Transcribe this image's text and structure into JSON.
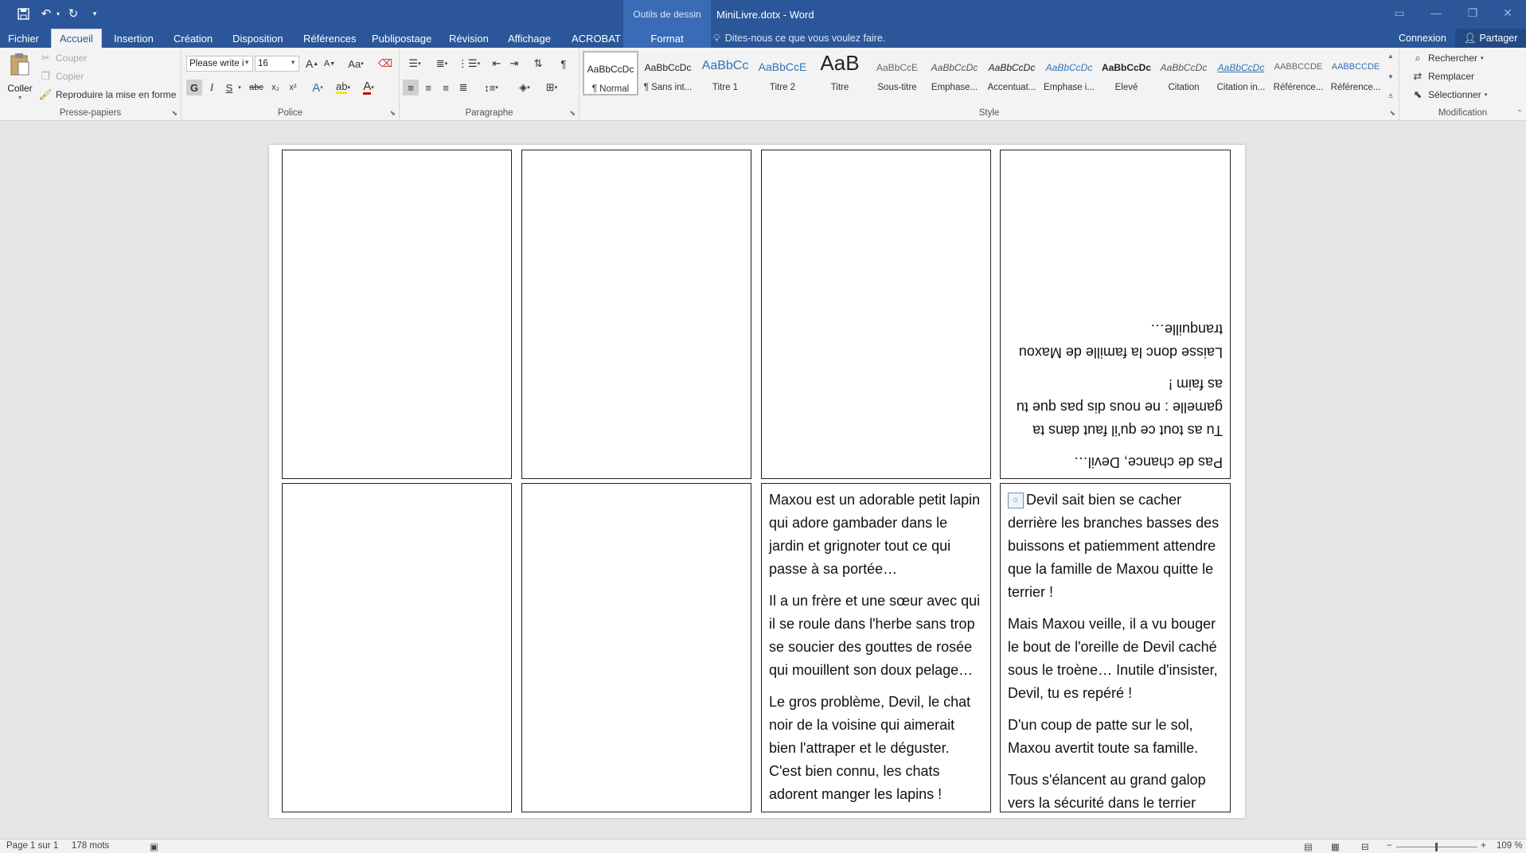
{
  "titlebar": {
    "quick_access": [
      "save-icon",
      "undo-icon",
      "redo-icon",
      "customize-icon"
    ],
    "context_header": "Outils de dessin",
    "doc_title": "MiniLivre.dotx - Word"
  },
  "tabs": [
    {
      "label": "Fichier"
    },
    {
      "label": "Accueil"
    },
    {
      "label": "Insertion"
    },
    {
      "label": "Création"
    },
    {
      "label": "Disposition"
    },
    {
      "label": "Références"
    },
    {
      "label": "Publipostage"
    },
    {
      "label": "Révision"
    },
    {
      "label": "Affichage"
    },
    {
      "label": "ACROBAT"
    },
    {
      "label": "Format"
    }
  ],
  "tellme": "Dites-nous ce que vous voulez faire.",
  "account": {
    "signin": "Connexion",
    "share": "Partager"
  },
  "ribbon": {
    "clipboard": {
      "paste": "Coller",
      "cut": "Couper",
      "copy": "Copier",
      "format_painter": "Reproduire la mise en forme",
      "label": "Presse-papiers"
    },
    "font": {
      "name": "Please write i",
      "size": "16",
      "label": "Police",
      "bold": "G",
      "italic": "I",
      "underline": "S",
      "strike": "abc",
      "subscript": "x₂",
      "superscript": "x²",
      "grow": "A",
      "shrink": "A",
      "case": "Aa"
    },
    "paragraph": {
      "label": "Paragraphe",
      "pilcrow": "¶"
    },
    "styles": {
      "label": "Style",
      "items": [
        {
          "preview": "AaBbCcDc",
          "name": "¶ Normal"
        },
        {
          "preview": "AaBbCcDc",
          "name": "¶ Sans int..."
        },
        {
          "preview": "AaBbCc",
          "name": "Titre 1"
        },
        {
          "preview": "AaBbCcE",
          "name": "Titre 2"
        },
        {
          "preview": "AaB",
          "name": "Titre"
        },
        {
          "preview": "AaBbCcE",
          "name": "Sous-titre"
        },
        {
          "preview": "AaBbCcDc",
          "name": "Emphase..."
        },
        {
          "preview": "AaBbCcDc",
          "name": "Accentuat..."
        },
        {
          "preview": "AaBbCcDc",
          "name": "Emphase i..."
        },
        {
          "preview": "AaBbCcDc",
          "name": "Élevé"
        },
        {
          "preview": "AaBbCcDc",
          "name": "Citation"
        },
        {
          "preview": "AaBbCcDc",
          "name": "Citation in..."
        },
        {
          "preview": "AABBCCDE",
          "name": "Référence..."
        },
        {
          "preview": "AABBCCDE",
          "name": "Référence..."
        }
      ]
    },
    "editing": {
      "find": "Rechercher",
      "replace": "Remplacer",
      "select": "Sélectionner",
      "label": "Modification"
    }
  },
  "document": {
    "upside_down_panel": [
      "Pas de chance, Devil…",
      "Tu as tout ce qu'il faut dans ta gamelle : ne nous dis pas que tu as faim !",
      "Laisse donc la famille de Maxou tranquille…"
    ],
    "panel_maxou": [
      "Maxou est un adorable petit lapin qui adore gambader dans le jardin et grignoter tout ce qui passe à sa portée…",
      "Il a un frère et une sœur avec qui il se roule dans l'herbe sans trop se soucier des gouttes de rosée qui mouillent son doux pelage…",
      "Le gros problème, Devil, le chat noir de la voisine qui aimerait bien l'attraper et le déguster. C'est bien connu, les chats adorent manger les lapins !"
    ],
    "panel_devil": [
      "Devil sait bien se cacher derrière les branches basses des buissons et patiemment attendre que la famille de Maxou quitte le terrier !",
      "Mais Maxou veille, il a vu bouger le bout de l'oreille de Devil caché sous le troène… Inutile d'insister, Devil, tu es repéré !",
      "D'un coup de patte sur le sol, Maxou avertit toute sa famille.",
      "Tous s'élancent au grand galop vers la sécurité dans le terrier familial !"
    ]
  },
  "status": {
    "page": "Page 1 sur 1",
    "words": "178 mots",
    "zoom": "109 %"
  },
  "colors": {
    "accent": "#2b579a",
    "ribbon": "#f3f3f3",
    "workspace": "#e6e6e6"
  }
}
